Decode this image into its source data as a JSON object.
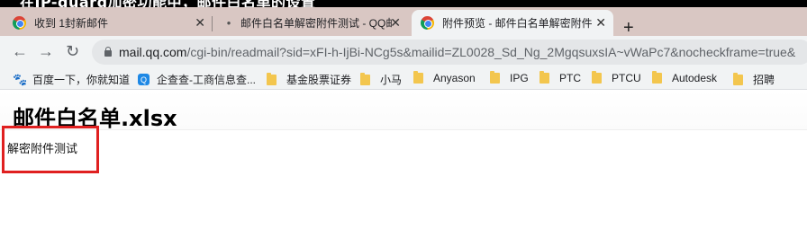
{
  "caption": "在IP-guard加密功能中，邮件白名单的设置",
  "tabs": [
    {
      "title": "收到 1封新邮件",
      "icon": "chrome-icon",
      "active": false
    },
    {
      "title": "邮件白名单解密附件测试 - QQ邮",
      "icon": "loading-dot-icon",
      "active": false
    },
    {
      "title": "附件预览 - 邮件白名单解密附件测",
      "icon": "chrome-icon",
      "active": true
    }
  ],
  "tab_close_glyph": "✕",
  "new_tab_glyph": "+",
  "toolbar": {
    "back_glyph": "←",
    "forward_glyph": "→",
    "reload_glyph": "↻",
    "url_host": "mail.qq.com",
    "url_path": "/cgi-bin/readmail?sid=xFI-h-IjBi-NCg5s&mailid=ZL0028_Sd_Ng_2MgqsuxsIA~vWaPc7&nocheckframe=true&"
  },
  "bookmarks": [
    {
      "label": "百度一下，你就知道",
      "icon": "baidu-paw-icon"
    },
    {
      "label": "企查查-工商信息查...",
      "icon": "qichacha-icon"
    },
    {
      "label": "基金股票证券",
      "icon": "folder-icon"
    },
    {
      "label": "小马",
      "icon": "folder-icon"
    },
    {
      "label": "Anyason",
      "icon": "folder-icon"
    },
    {
      "label": "IPG",
      "icon": "folder-icon"
    },
    {
      "label": "PTC",
      "icon": "folder-icon"
    },
    {
      "label": "PTCU",
      "icon": "folder-icon"
    },
    {
      "label": "Autodesk",
      "icon": "folder-icon"
    },
    {
      "label": "招聘",
      "icon": "folder-icon"
    }
  ],
  "page": {
    "file_title": "邮件白名单.xlsx",
    "body_text": "解密附件测试"
  },
  "colors": {
    "tabbar": "#d9c7c3",
    "toolbar": "#f1f3f4",
    "highlight": "#e02020",
    "folder": "#f3c64e"
  }
}
